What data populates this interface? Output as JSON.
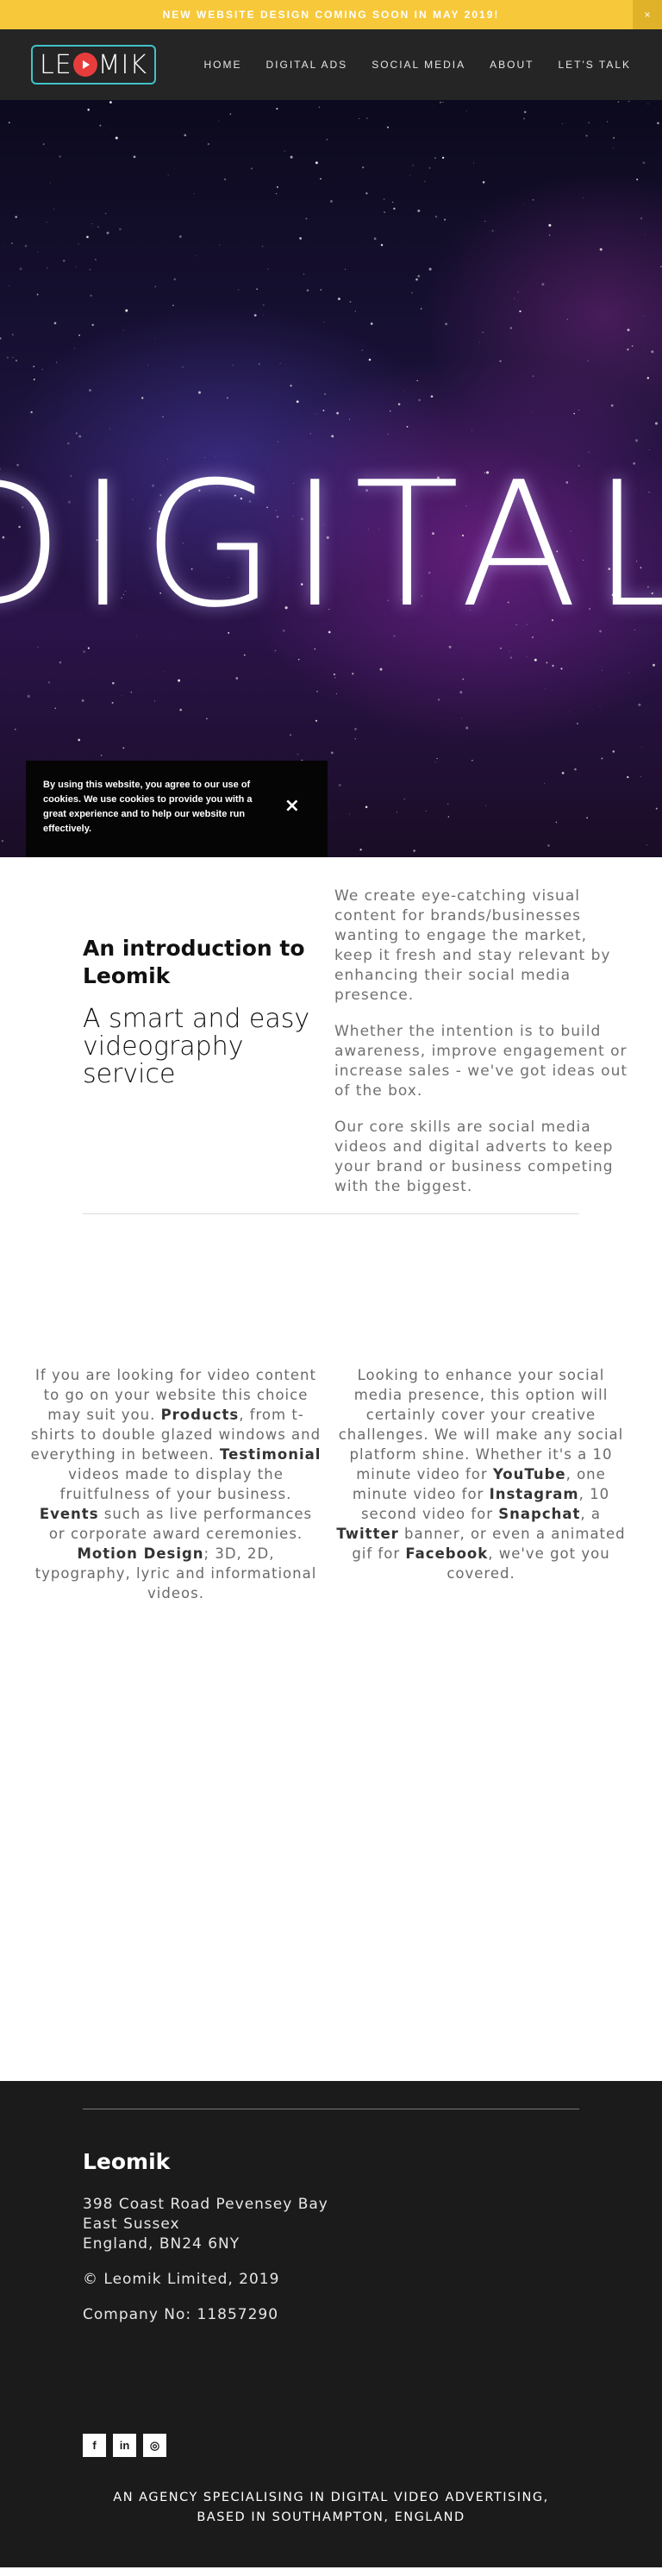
{
  "announcement": {
    "text": "NEW WEBSITE DESIGN COMING SOON IN MAY 2019!",
    "close": "×"
  },
  "header": {
    "logo": {
      "left": "LE",
      "right": "MIK"
    },
    "nav": [
      "HOME",
      "DIGITAL ADS",
      "SOCIAL MEDIA",
      "ABOUT",
      "LET'S TALK"
    ]
  },
  "hero": {
    "big_text": "DIGITAL ADS",
    "cookie_text": "By using this website, you agree to our use of cookies. We use cookies to provide you with a great experience and to help our website run effectively.",
    "cookie_close": "×"
  },
  "intro": {
    "title": "An introduction to Leomik",
    "subtitle": "A smart and easy videography service",
    "paragraphs": [
      "We create eye-catching visual content for brands/businesses wanting to engage the market, keep it fresh and stay relevant by enhancing their social media presence.",
      "Whether the intention is to build awareness, improve engagement or increase sales - we've got ideas out of the box.",
      "Our core skills are social media videos and digital adverts to keep your brand or business competing with the biggest."
    ]
  },
  "services": {
    "left": {
      "t1": "If you are looking for video content to go on your website this choice may suit you. ",
      "b1": "Products",
      "t2": ", from t-shirts to double glazed windows and everything in between. ",
      "b2": "Testimonial",
      "t3": " videos made to display the fruitfulness of your business. ",
      "b3": "Events",
      "t4": " such as live performances or corporate award ceremonies. ",
      "b4": "Motion Design",
      "t5": ";  3D, 2D, typography, lyric and informational videos."
    },
    "right": {
      "t1": "Looking to enhance your social media presence, this option will certainly cover your creative challenges. We will make any social platform shine. Whether it's a 10 minute video for ",
      "b1": "YouTube",
      "t2": ", one minute video for ",
      "b2": "Instagram",
      "t3": ", 10 second video for ",
      "b3": "Snapchat",
      "t4": ", a ",
      "b4": "Twitter",
      "t5": " banner, or even a animated gif for ",
      "b5": "Facebook",
      "t6": ", we've got you covered."
    }
  },
  "footer": {
    "name": "Leomik",
    "address": [
      "398 Coast Road Pevensey Bay",
      "East Sussex",
      "England, BN24 6NY"
    ],
    "copyright": "© Leomik Limited, 2019",
    "company": "Company No: 11857290",
    "socials": [
      {
        "icon": "facebook-icon",
        "glyph": "f"
      },
      {
        "icon": "linkedin-icon",
        "glyph": "in"
      },
      {
        "icon": "instagram-icon",
        "glyph": "◎"
      }
    ],
    "tagline": [
      "AN AGENCY SPECIALISING IN DIGITAL VIDEO ADVERTISING,",
      "BASED IN SOUTHAMPTON, ENGLAND"
    ]
  }
}
